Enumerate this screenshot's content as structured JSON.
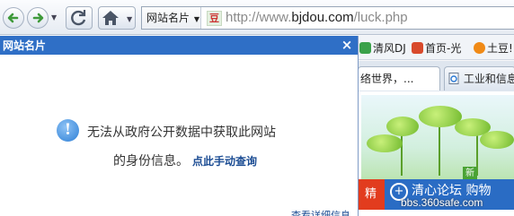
{
  "toolbar": {
    "back_icon": "back-arrow-icon",
    "forward_icon": "forward-arrow-icon",
    "refresh_icon": "refresh-icon",
    "home_icon": "home-icon",
    "address_label": "网站名片",
    "address_url_prefix": "http://www.",
    "address_url_domain": "bjdou.com",
    "address_url_path": "/luck.php",
    "site_icon_glyph": "豆"
  },
  "bookmarks": [
    {
      "label": "清风DJ",
      "icon_color": "#3aa14a"
    },
    {
      "label": "首页-光",
      "icon_color": "#d84a2c"
    },
    {
      "label": "土豆!",
      "icon_color": "#f08a16"
    }
  ],
  "tabs": [
    {
      "label": "络世界，..."
    },
    {
      "label": "工业和信息"
    }
  ],
  "popup": {
    "title": "网站名片",
    "close_glyph": "×",
    "message_line1": "无法从政府公开数据中获取此网站",
    "message_line2": "的身份信息。",
    "query_link": "点此手动查询",
    "footer_link": "查看详细信息"
  },
  "page": {
    "badge": "新",
    "banner_left": "精",
    "banner_text": "清心论坛  购物",
    "watermark": "bbs.360safe.com"
  },
  "colors": {
    "popup_header": "#2f6fc6",
    "link": "#1b4c93"
  }
}
